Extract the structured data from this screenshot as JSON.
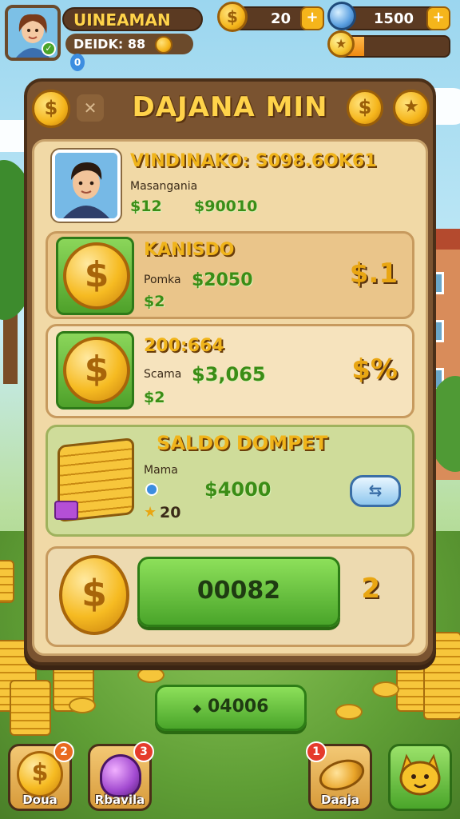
{
  "player": {
    "name": "UINEAMAN",
    "id_label": "DEIDK: 88",
    "id_value": "0"
  },
  "currency": {
    "coins": "20",
    "gems": "1500",
    "xp_level": 0.25
  },
  "panel": {
    "title": "DAJANA MIN",
    "close_icon": "x-icon",
    "profile": {
      "title": "VINDINAKO: S098.6OK61",
      "subtitle": "Masangania",
      "stat1": "$12",
      "stat2": "$90010"
    },
    "rows": [
      {
        "title": "KANISDO",
        "label": "Pomka",
        "amount": "$2050",
        "sub": "$2",
        "right": "$.1"
      },
      {
        "title": "200:664",
        "label": "Scama",
        "amount": "$3,065",
        "sub": "$2",
        "right": "$%"
      }
    ],
    "wallet": {
      "title": "SALDO DOMPET",
      "label": "Mama",
      "amount": "$4000",
      "sub": "20"
    },
    "action": {
      "button_label": "00082",
      "count": "2"
    }
  },
  "bottom_button": {
    "label": "04006"
  },
  "nav": [
    {
      "label": "Doua",
      "badge": "2",
      "icon": "coin-icon"
    },
    {
      "label": "Rbavila",
      "badge": "3",
      "icon": "potion-icon"
    },
    {
      "label": "Daaja",
      "badge": "1",
      "icon": "bread-icon"
    },
    {
      "label": "",
      "badge": "",
      "icon": "creature-icon"
    }
  ],
  "colors": {
    "panel_brown": "#7a5330",
    "gold": "#f0b41a",
    "green": "#4aa52a"
  }
}
